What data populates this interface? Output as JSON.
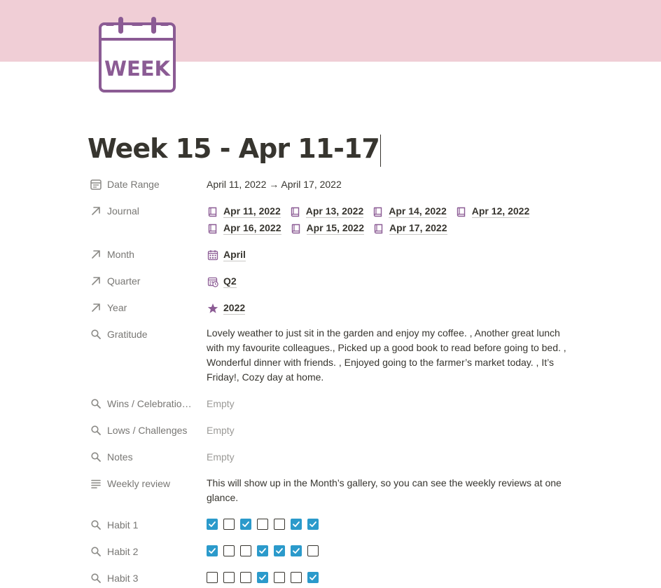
{
  "page": {
    "title": "Week 15 - Apr 11-17",
    "icon": "calendar-week-icon",
    "icon_text": "WEEK",
    "cover_color": "#f0ced6",
    "accent_color": "#8b5b94"
  },
  "properties": {
    "date_range": {
      "label": "Date Range",
      "icon": "calendar-icon",
      "value": "April 11, 2022 → April 17, 2022"
    },
    "journal": {
      "label": "Journal",
      "icon": "relation-arrow-icon",
      "items": [
        "Apr 11, 2022",
        "Apr 13, 2022",
        "Apr 14, 2022",
        "Apr 12, 2022",
        "Apr 16, 2022",
        "Apr 15, 2022",
        "Apr 17, 2022"
      ]
    },
    "month": {
      "label": "Month",
      "icon": "relation-arrow-icon",
      "value": "April",
      "value_icon": "calendar-grid-icon"
    },
    "quarter": {
      "label": "Quarter",
      "icon": "relation-arrow-icon",
      "value": "Q2",
      "value_icon": "calendar-clock-icon"
    },
    "year": {
      "label": "Year",
      "icon": "relation-arrow-icon",
      "value": "2022",
      "value_icon": "star-icon"
    },
    "gratitude": {
      "label": "Gratitude",
      "icon": "rollup-search-icon",
      "value": "Lovely weather to just sit in the garden and enjoy my coffee. , Another great lunch with my favourite colleagues., Picked up a good book to read before going to bed. , Wonderful dinner with friends. , Enjoyed going to the farmer’s market today. , It’s Friday!, Cozy day at home."
    },
    "wins": {
      "label": "Wins / Celebratio…",
      "icon": "rollup-search-icon",
      "value": "Empty"
    },
    "lows": {
      "label": "Lows / Challenges",
      "icon": "rollup-search-icon",
      "value": "Empty"
    },
    "notes": {
      "label": "Notes",
      "icon": "rollup-search-icon",
      "value": "Empty"
    },
    "weekly_review": {
      "label": "Weekly review",
      "icon": "text-lines-icon",
      "value": "This will show up in the Month’s gallery, so you can see the weekly reviews at one glance."
    },
    "habits": [
      {
        "label": "Habit 1",
        "icon": "rollup-search-icon",
        "checks": [
          true,
          false,
          true,
          false,
          false,
          true,
          true
        ]
      },
      {
        "label": "Habit 2",
        "icon": "rollup-search-icon",
        "checks": [
          true,
          false,
          false,
          true,
          true,
          true,
          false
        ]
      },
      {
        "label": "Habit 3",
        "icon": "rollup-search-icon",
        "checks": [
          false,
          false,
          false,
          true,
          false,
          false,
          true
        ]
      }
    ]
  },
  "colors": {
    "check_on": "#2b9acb",
    "text": "#37352f",
    "muted": "#787774",
    "placeholder": "#9b9a97"
  }
}
